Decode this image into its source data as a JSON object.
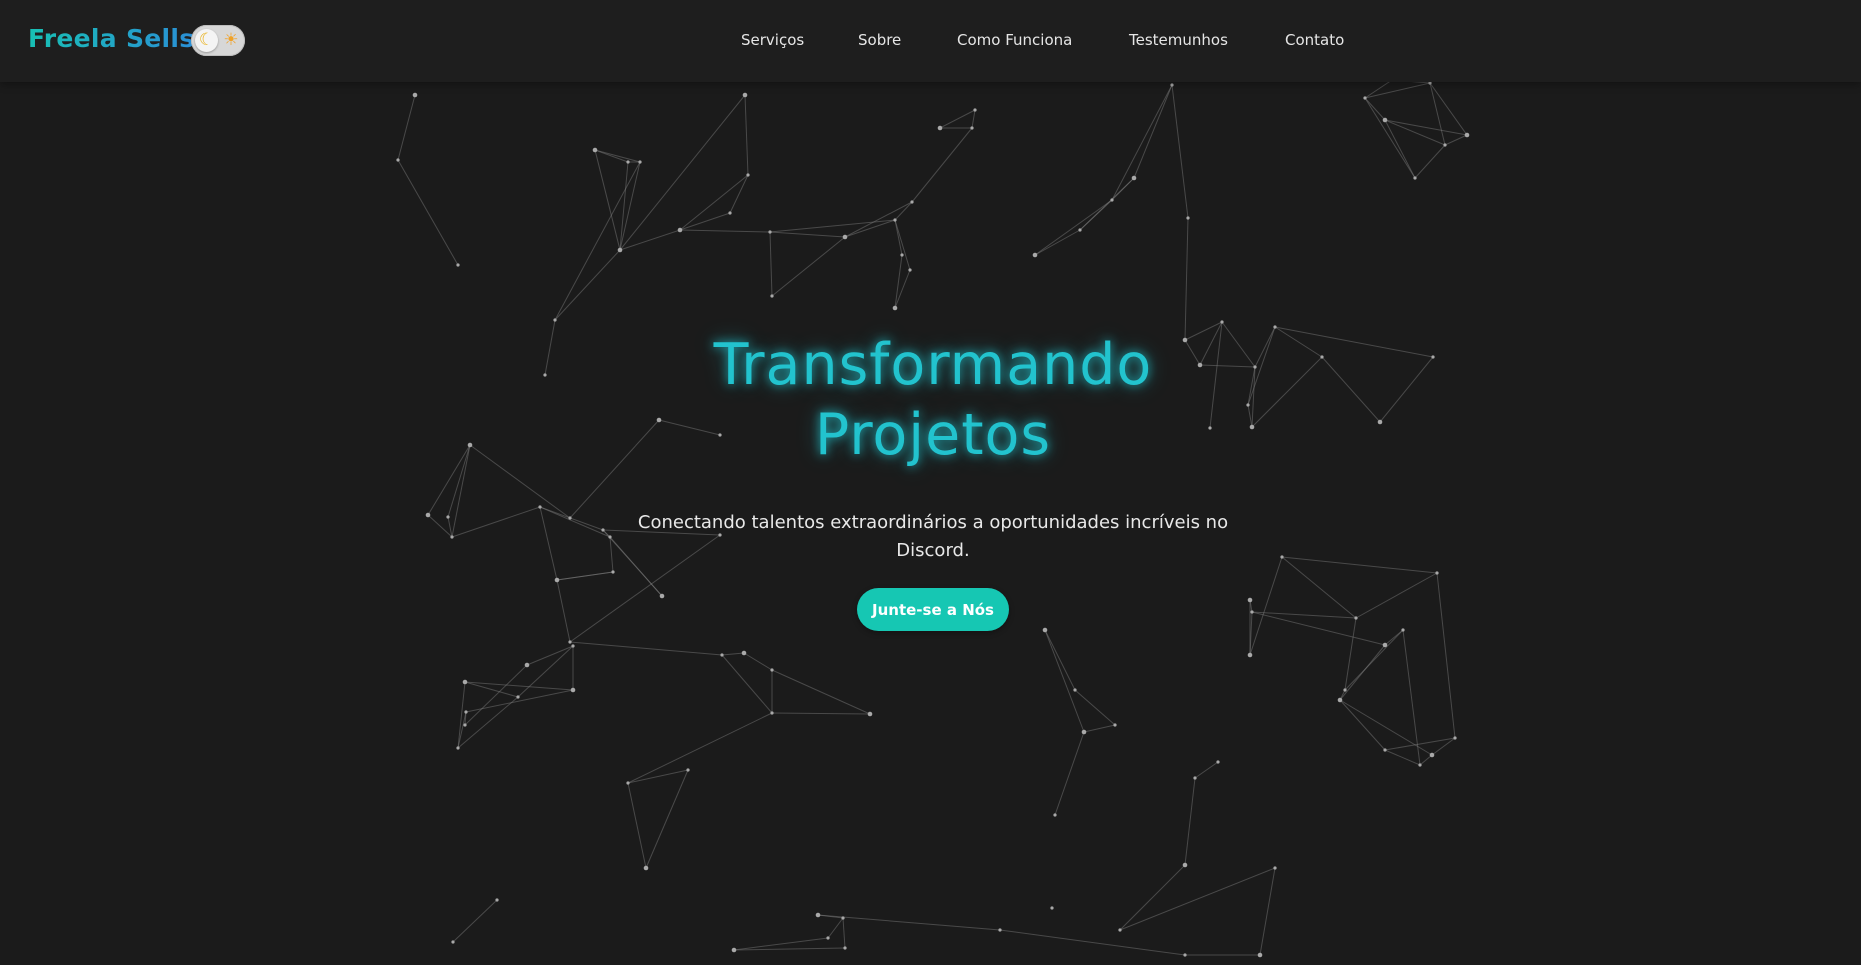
{
  "brand": {
    "name": "Freela Sells",
    "gradient": [
      "#18c0b4",
      "#2a8fd6"
    ]
  },
  "theme_toggle": {
    "moon_icon": "moon-icon",
    "sun_icon": "sun-icon",
    "moon_glyph": "☾",
    "sun_glyph": "☀"
  },
  "nav": {
    "links": [
      {
        "label": "Serviços"
      },
      {
        "label": "Sobre"
      },
      {
        "label": "Como Funciona"
      },
      {
        "label": "Testemunhos"
      },
      {
        "label": "Contato"
      }
    ]
  },
  "hero": {
    "title_line1": "Transformando",
    "title_line2": "Projetos",
    "subtitle_line1": "Conectando talentos extraordinários a oportunidades incríveis no",
    "subtitle_line2": "Discord.",
    "cta_label": "Junte-se a Nós"
  },
  "colors": {
    "background": "#1b1b1b",
    "navbar": "#1e1e1e",
    "accent": "#22c3ce",
    "button": "#16c7b3",
    "network": "#8a8a8a"
  }
}
